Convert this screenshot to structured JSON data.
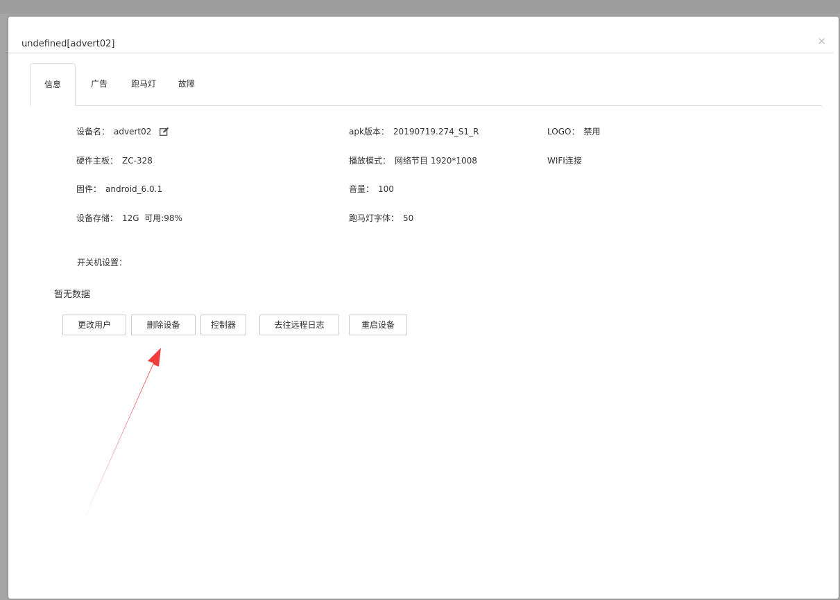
{
  "dialog": {
    "title": "undefined[advert02]",
    "close_label": "×"
  },
  "tabs": [
    {
      "label": "信息",
      "active": true
    },
    {
      "label": "广告",
      "active": false
    },
    {
      "label": "跑马灯",
      "active": false
    },
    {
      "label": "故障",
      "active": false
    }
  ],
  "info": {
    "device_name": {
      "label": "设备名：",
      "value": "advert02"
    },
    "hardware_board": {
      "label": "硬件主板：",
      "value": "ZC-328"
    },
    "firmware": {
      "label": "固件：",
      "value": "android_6.0.1"
    },
    "storage": {
      "label": "设备存储：",
      "value": "12G  可用:98%"
    },
    "apk_version": {
      "label": "apk版本：",
      "value": "20190719.274_S1_R"
    },
    "play_mode": {
      "label": "播放模式：",
      "value": "网络节目 1920*1008"
    },
    "volume": {
      "label": "音量：",
      "value": "100"
    },
    "marquee_font": {
      "label": "跑马灯字体：",
      "value": "50"
    },
    "logo": {
      "label": "LOGO：",
      "value": "禁用"
    },
    "network": {
      "value": "WIFI连接"
    }
  },
  "power_schedule": {
    "label": "开关机设置：",
    "empty_text": "暂无数据"
  },
  "actions": [
    {
      "label": "更改用户"
    },
    {
      "label": "删除设备"
    },
    {
      "label": "控制器"
    },
    {
      "label": "去往远程日志"
    },
    {
      "label": "重启设备"
    }
  ],
  "colors": {
    "annotation_arrow": "#f03c3c",
    "backdrop": "#a6a6a6",
    "border": "#cccccc"
  },
  "icons": {
    "edit": "edit-icon",
    "close": "close-icon"
  }
}
